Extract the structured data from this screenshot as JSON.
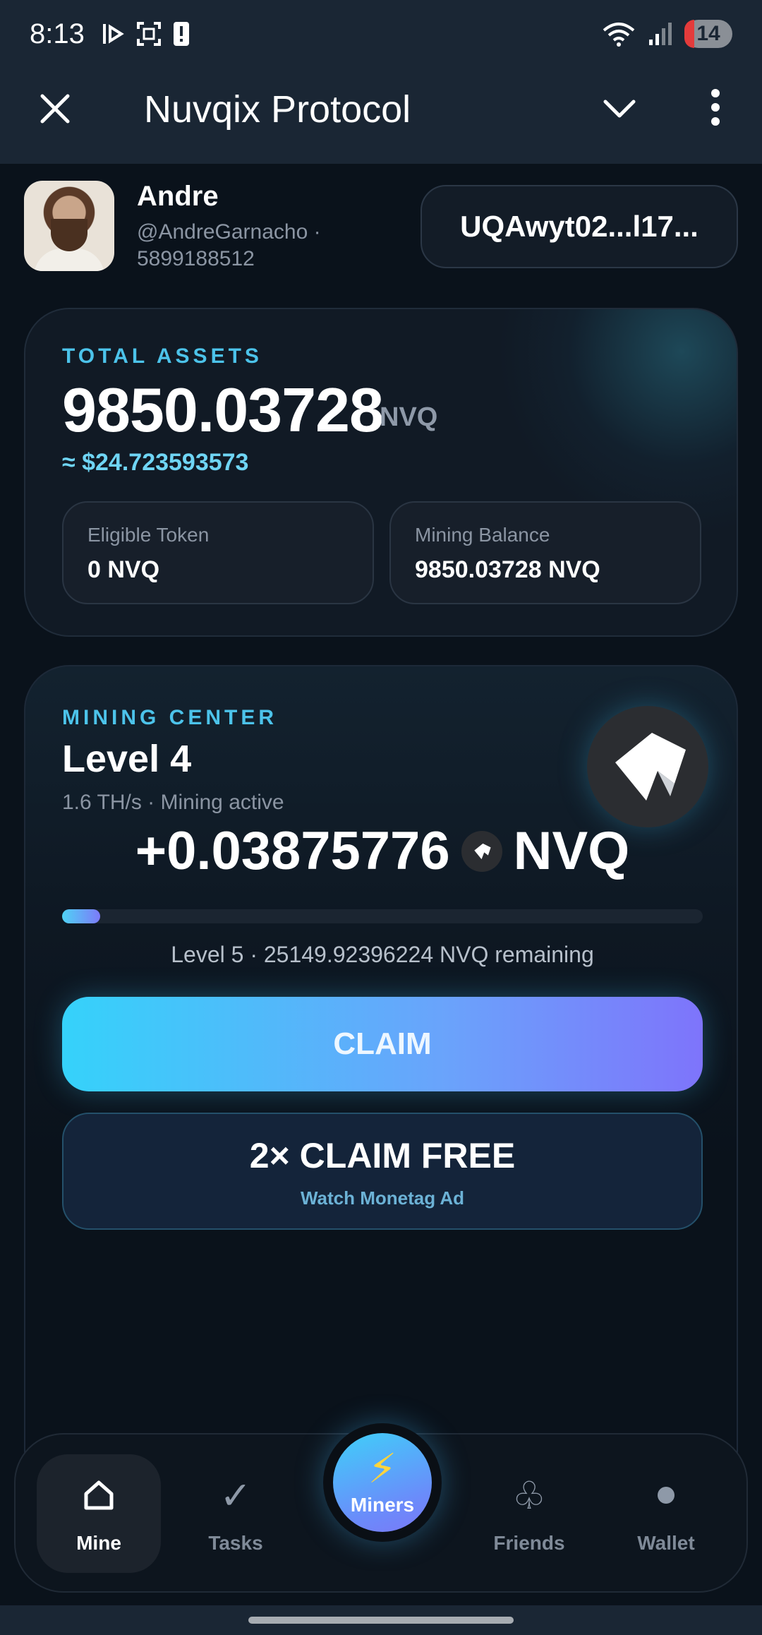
{
  "status_bar": {
    "time": "8:13",
    "battery": "14",
    "icons": [
      "play-icon",
      "screenshot-icon",
      "alert-icon",
      "wifi-icon",
      "signal-icon"
    ]
  },
  "header": {
    "title": "Nuvqix Protocol",
    "icons": [
      "close-icon",
      "chevron-down-icon",
      "more-vertical-icon"
    ]
  },
  "profile": {
    "name": "Andre",
    "handle": "@AndreGarnacho ·",
    "user_id": "5899188512",
    "wallet_address": "UQAwyt02...l17..."
  },
  "assets": {
    "eyebrow": "TOTAL ASSETS",
    "amount": "9850.03728",
    "unit": "NVQ",
    "usd": "≈ $24.723593573",
    "eligible_label": "Eligible Token",
    "eligible_value": "0 NVQ",
    "mining_balance_label": "Mining Balance",
    "mining_balance_value": "9850.03728 NVQ"
  },
  "mining": {
    "eyebrow": "MINING CENTER",
    "level": "Level 4",
    "rate_status": "1.6 TH/s · Mining active",
    "counter_value": "+0.03875776",
    "counter_unit": "NVQ",
    "progress_fraction": 0.06,
    "progress_text": "Level 5 · 25149.92396224 NVQ remaining",
    "claim_label": "CLAIM",
    "claim2_title": "2× CLAIM FREE",
    "claim2_sub": "Watch Monetag Ad"
  },
  "nav": {
    "items": [
      {
        "label": "Mine",
        "icon": "home-icon",
        "active": true
      },
      {
        "label": "Tasks",
        "icon": "check-icon",
        "active": false
      },
      {
        "label": "Miners",
        "icon": "lightning-icon",
        "active": false
      },
      {
        "label": "Friends",
        "icon": "club-icon",
        "active": false
      },
      {
        "label": "Wallet",
        "icon": "circle-icon",
        "active": false
      }
    ]
  },
  "colors": {
    "accent_cyan": "#4cc3ea",
    "usd_cyan": "#6fd5f5",
    "claim_gradient_start": "#35d2fa",
    "claim_gradient_end": "#7e74fb",
    "background": "#0a121b"
  }
}
